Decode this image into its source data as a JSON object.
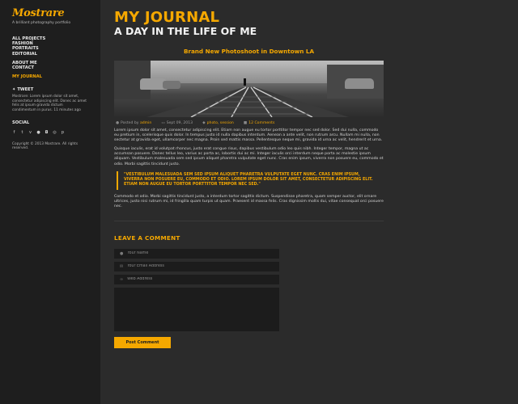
{
  "sidebar": {
    "logo": "Mostrare",
    "tagline": "A brilliant photography portfolio",
    "nav_group1": [
      "ALL PROJECTS",
      "FASHION",
      "PORTRAITS",
      "EDITORIAL"
    ],
    "nav_group2": [
      "ABOUT ME",
      "CONTACT"
    ],
    "nav_active": "MY JOURNAL",
    "tweet_heading": "TWEET",
    "tweet_text": "Mostrare: Lorem ipsum dolor sit amet, consectetur adipiscing elit. Donec ac amet felis at ipsum gravida dictum condimentum in purus. 11 minutes ago",
    "social_heading": "SOCIAL",
    "social_icons": [
      "facebook-icon",
      "twitter-icon",
      "vimeo-icon",
      "flickr-icon",
      "instagram-icon",
      "dribbble-icon",
      "pinterest-icon"
    ],
    "copyright": "Copyright © 2013 Mostrare. All rights reserved."
  },
  "main": {
    "title": "MY JOURNAL",
    "subtitle": "A DAY IN THE LIFE OF ME",
    "post_title": "Brand New Photoshoot in Downtown LA",
    "meta": {
      "posted_by_label": "Posted by",
      "author": "admin",
      "date": "Sept 09, 2013",
      "tags": "photo, session",
      "comments": "12 Comments"
    },
    "paragraph1": "Lorem ipsum dolor sit amet, consectetur adipiscing elit. Etiam non augue eu tortor porttitor tempor nec sed dolor. Sed dui nulla, commodo eu pretium in, scelerisque quis dolor. In tempus justo id nulla dapibus interdum. Aenean a ante velit, non rutrum arcu. Nullam mi nulla, non sectetur at gravida eget, ullamcorper nec magna. Proin sed mattis massa. Pellentesque neque mi, gravida id urna ac velit, hendrerit et urna.",
    "paragraph2": "Quisque iaculis, erat id volutpat rhoncus, justo erat congue risus, dapibus vestibulum odio leo quis nibh. Integer tempor, magna ut ac accumsan posuere. Donec tellus leo, varius ac porta ac, lobortis dui ac mi. Integer iaculis orci interdum neque porta ac molestie ipsum aliquam. Vestibulum malesuada sem sed ipsum aliquet pharetra vulputate eget nunc. Cras enim ipsum, viverra non posuere eu, commodo et odio. Morbi sagittis tincidunt justo.",
    "quote": "\"Vestibulum malesuada sem sed ipsum aliquet pharetra vulputate eget nunc. Cras enim ipsum, viverra non posuere eu, commodo et odio. Lorem ipsum dolor sit amet, consectetur adipiscing elit. Etiam non augue eu tortor porttitor tempor nec sed.\"",
    "paragraph3": "Commodo et odio. Morbi sagittis tincidunt justo, a interdum tortor sagittis dictum. Suspendisse pharetra, quam semper auctor, elit ornare ultrices, justo nisi rutrum mi, id fringilla quam turpis ut quam. Praesent id massa felis. Cras dignissim mollis dui, vitae consequat orci posuere nec."
  },
  "comment_form": {
    "heading": "LEAVE A COMMENT",
    "name_placeholder": "Your Name",
    "email_placeholder": "Your Email Address",
    "web_placeholder": "Web Address",
    "submit_label": "Post Comment"
  },
  "colors": {
    "accent": "#f5a800",
    "background": "#2b2b2b",
    "sidebar": "#1e1e1e"
  }
}
